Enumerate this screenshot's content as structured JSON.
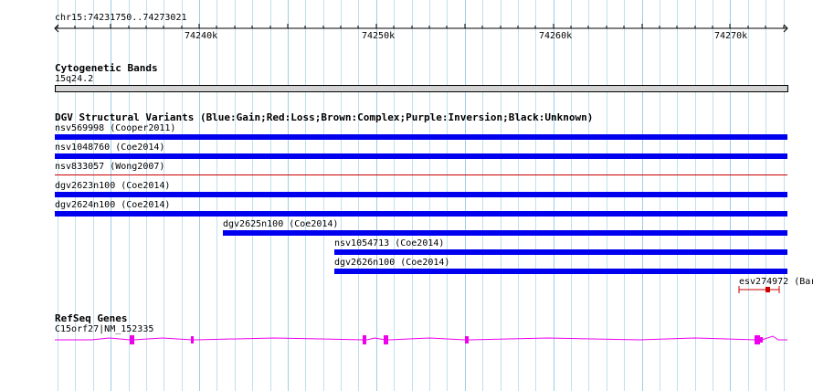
{
  "ruler": {
    "location": "chr15:74231750..74273021",
    "ticks": [
      "74240k",
      "74250k",
      "74260k",
      "74270k"
    ]
  },
  "cytoband_track": {
    "title": "Cytogenetic Bands",
    "band_label": "15q24.2"
  },
  "dgv_track": {
    "title": "DGV Structural Variants (Blue:Gain;Red:Loss;Brown:Complex;Purple:Inversion;Black:Unknown)",
    "variants": [
      {
        "label": "nsv569998 (Cooper2011)",
        "type": "gain"
      },
      {
        "label": "nsv1048760 (Coe2014)",
        "type": "gain"
      },
      {
        "label": "nsv833057 (Wong2007)",
        "type": "loss"
      },
      {
        "label": "dgv2623n100 (Coe2014)",
        "type": "gain"
      },
      {
        "label": "dgv2624n100 (Coe2014)",
        "type": "gain"
      },
      {
        "label": "dgv2625n100 (Coe2014)",
        "type": "gain"
      },
      {
        "label": "nsv1054713 (Coe2014)",
        "type": "gain"
      },
      {
        "label": "dgv2626n100 (Coe2014)",
        "type": "gain"
      },
      {
        "label": "esv274972 (Bar",
        "type": "loss"
      }
    ]
  },
  "refseq_track": {
    "title": "RefSeq Genes",
    "gene_label": "C15orf27|NM_152335"
  },
  "colors": {
    "gain": "#0000ee",
    "loss": "#cc0000",
    "gene": "#ee00ee",
    "grid": "#bfe0ef",
    "band_fill": "#d3d3d3"
  }
}
